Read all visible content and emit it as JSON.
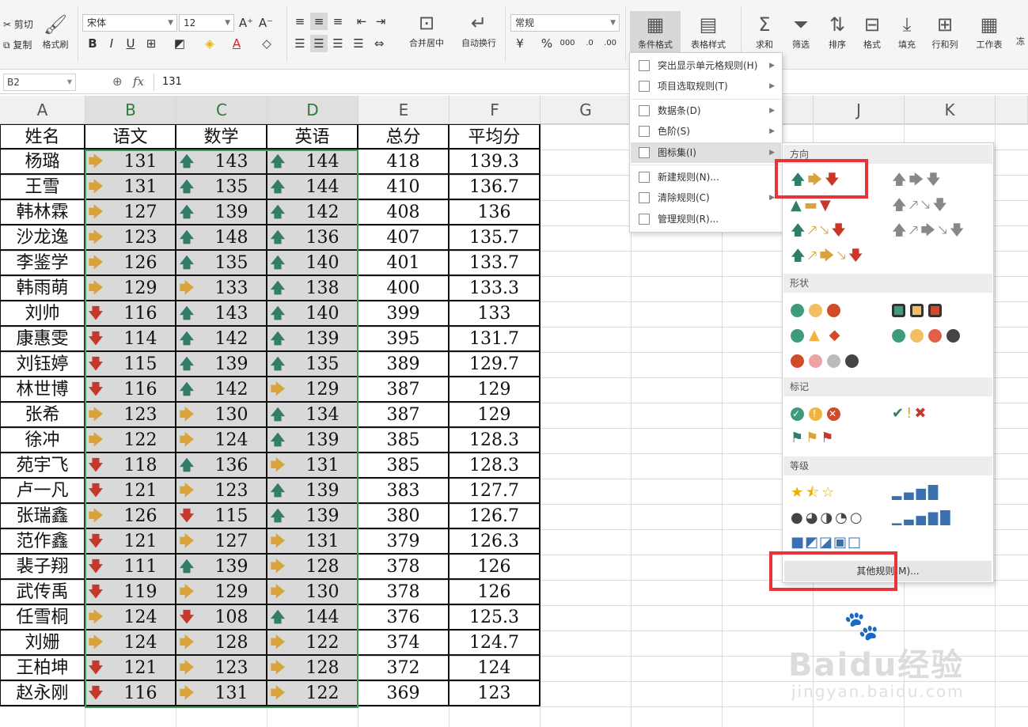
{
  "ribbon": {
    "cut": "剪切",
    "copy": "复制",
    "format_painter": "格式刷",
    "font_name": "宋体",
    "font_size": "12",
    "number_format": "常规",
    "merge_center": "合并居中",
    "auto_wrap": "自动换行",
    "conditional_format": "条件格式",
    "table_style": "表格样式",
    "sum": "求和",
    "filter": "筛选",
    "sort": "排序",
    "format": "格式",
    "fill": "填充",
    "row_col": "行和列",
    "worksheet": "工作表",
    "more": "冻"
  },
  "formula_bar": {
    "name_box": "B2",
    "fx": "fx",
    "value": "131"
  },
  "columns": [
    "A",
    "B",
    "C",
    "D",
    "E",
    "F",
    "G",
    "H",
    "I",
    "J",
    "K"
  ],
  "table": {
    "headers": [
      "姓名",
      "语文",
      "数学",
      "英语",
      "总分",
      "平均分"
    ],
    "rows": [
      {
        "name": "杨璐",
        "c": 131,
        "ci": "rt",
        "m": 143,
        "mi": "up",
        "e": 144,
        "ei": "up",
        "total": 418,
        "avg": "139.3"
      },
      {
        "name": "王雪",
        "c": 131,
        "ci": "rt",
        "m": 135,
        "mi": "up",
        "e": 144,
        "ei": "up",
        "total": 410,
        "avg": "136.7"
      },
      {
        "name": "韩林霖",
        "c": 127,
        "ci": "rt",
        "m": 139,
        "mi": "up",
        "e": 142,
        "ei": "up",
        "total": 408,
        "avg": "136"
      },
      {
        "name": "沙龙逸",
        "c": 123,
        "ci": "rt",
        "m": 148,
        "mi": "up",
        "e": 136,
        "ei": "up",
        "total": 407,
        "avg": "135.7"
      },
      {
        "name": "李鉴学",
        "c": 126,
        "ci": "rt",
        "m": 135,
        "mi": "up",
        "e": 140,
        "ei": "up",
        "total": 401,
        "avg": "133.7"
      },
      {
        "name": "韩雨萌",
        "c": 129,
        "ci": "rt",
        "m": 133,
        "mi": "rt",
        "e": 138,
        "ei": "up",
        "total": 400,
        "avg": "133.3"
      },
      {
        "name": "刘帅",
        "c": 116,
        "ci": "dn",
        "m": 143,
        "mi": "up",
        "e": 140,
        "ei": "up",
        "total": 399,
        "avg": "133"
      },
      {
        "name": "康惠雯",
        "c": 114,
        "ci": "dn",
        "m": 142,
        "mi": "up",
        "e": 139,
        "ei": "up",
        "total": 395,
        "avg": "131.7"
      },
      {
        "name": "刘钰婷",
        "c": 115,
        "ci": "dn",
        "m": 139,
        "mi": "up",
        "e": 135,
        "ei": "up",
        "total": 389,
        "avg": "129.7"
      },
      {
        "name": "林世博",
        "c": 116,
        "ci": "dn",
        "m": 142,
        "mi": "up",
        "e": 129,
        "ei": "rt",
        "total": 387,
        "avg": "129"
      },
      {
        "name": "张希",
        "c": 123,
        "ci": "rt",
        "m": 130,
        "mi": "rt",
        "e": 134,
        "ei": "up",
        "total": 387,
        "avg": "129"
      },
      {
        "name": "徐冲",
        "c": 122,
        "ci": "rt",
        "m": 124,
        "mi": "rt",
        "e": 139,
        "ei": "up",
        "total": 385,
        "avg": "128.3"
      },
      {
        "name": "苑宇飞",
        "c": 118,
        "ci": "dn",
        "m": 136,
        "mi": "up",
        "e": 131,
        "ei": "rt",
        "total": 385,
        "avg": "128.3"
      },
      {
        "name": "卢一凡",
        "c": 121,
        "ci": "dn",
        "m": 123,
        "mi": "rt",
        "e": 139,
        "ei": "up",
        "total": 383,
        "avg": "127.7"
      },
      {
        "name": "张瑞鑫",
        "c": 126,
        "ci": "rt",
        "m": 115,
        "mi": "dn",
        "e": 139,
        "ei": "up",
        "total": 380,
        "avg": "126.7"
      },
      {
        "name": "范作鑫",
        "c": 121,
        "ci": "dn",
        "m": 127,
        "mi": "rt",
        "e": 131,
        "ei": "rt",
        "total": 379,
        "avg": "126.3"
      },
      {
        "name": "裴子翔",
        "c": 111,
        "ci": "dn",
        "m": 139,
        "mi": "up",
        "e": 128,
        "ei": "rt",
        "total": 378,
        "avg": "126"
      },
      {
        "name": "武传禹",
        "c": 119,
        "ci": "dn",
        "m": 129,
        "mi": "rt",
        "e": 130,
        "ei": "rt",
        "total": 378,
        "avg": "126"
      },
      {
        "name": "任雪桐",
        "c": 124,
        "ci": "rt",
        "m": 108,
        "mi": "dn",
        "e": 144,
        "ei": "up",
        "total": 376,
        "avg": "125.3"
      },
      {
        "name": "刘姗",
        "c": 124,
        "ci": "rt",
        "m": 128,
        "mi": "rt",
        "e": 122,
        "ei": "rt",
        "total": 374,
        "avg": "124.7"
      },
      {
        "name": "王柏坤",
        "c": 121,
        "ci": "dn",
        "m": 123,
        "mi": "rt",
        "e": 128,
        "ei": "rt",
        "total": 372,
        "avg": "124"
      },
      {
        "name": "赵永刚",
        "c": 116,
        "ci": "dn",
        "m": 131,
        "mi": "rt",
        "e": 122,
        "ei": "rt",
        "total": 369,
        "avg": "123"
      }
    ]
  },
  "cond_menu": {
    "items": [
      "突出显示单元格规则(H)",
      "项目选取规则(T)",
      "数据条(D)",
      "色阶(S)",
      "图标集(I)",
      "新建规则(N)...",
      "清除规则(C)",
      "管理规则(R)..."
    ]
  },
  "icon_menu": {
    "sections": [
      "方向",
      "形状",
      "标记",
      "等级"
    ],
    "other_rules": "其他规则(M)..."
  },
  "watermark": {
    "logo": "Baidu经验",
    "url": "jingyan.baidu.com"
  }
}
